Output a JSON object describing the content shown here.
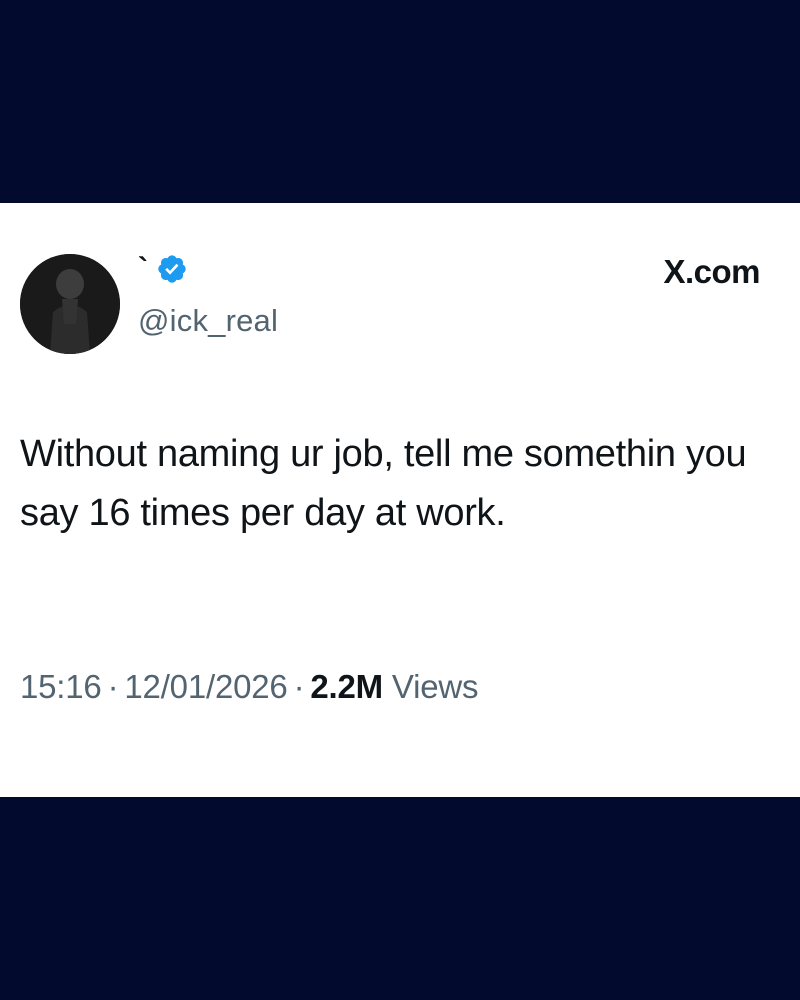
{
  "tweet": {
    "display_name": "`",
    "handle": "@ick_real",
    "verified_icon": "verified-badge-icon",
    "source_label": "X.com",
    "text": "Without naming ur job, tell me somethin you say 16 times per day at work.",
    "time": "15:16",
    "date": "12/01/2026",
    "separator": "·",
    "views_count": "2.2M",
    "views_label": "Views"
  },
  "colors": {
    "background": "#020a2e",
    "card": "#ffffff",
    "text_primary": "#0f1419",
    "text_secondary": "#536471",
    "verified_blue": "#1d9bf0"
  }
}
